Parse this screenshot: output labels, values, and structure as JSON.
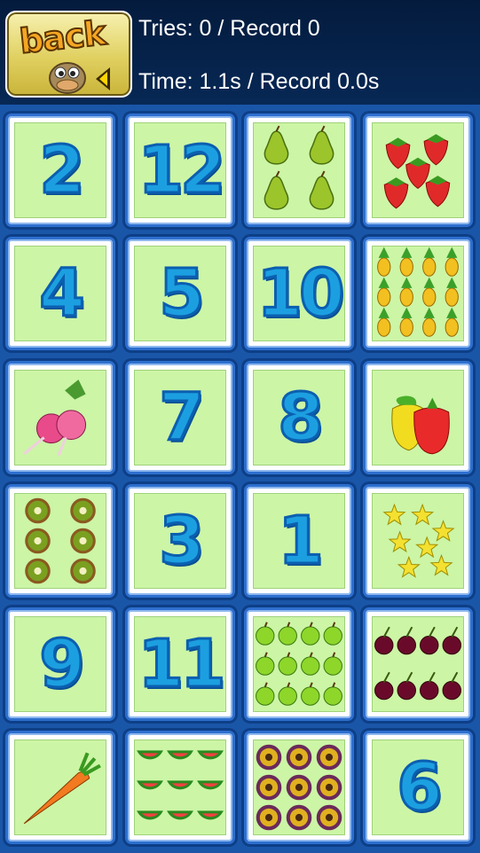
{
  "header": {
    "back_label": "back",
    "tries": "Tries: 0 / Record 0",
    "time": "Time: 1.1s / Record 0.0s"
  },
  "board": {
    "rows": [
      [
        {
          "kind": "number",
          "value": "2"
        },
        {
          "kind": "number",
          "value": "12"
        },
        {
          "kind": "picture",
          "name": "pears"
        },
        {
          "kind": "picture",
          "name": "strawberries"
        }
      ],
      [
        {
          "kind": "number",
          "value": "4"
        },
        {
          "kind": "number",
          "value": "5"
        },
        {
          "kind": "number",
          "value": "10"
        },
        {
          "kind": "picture",
          "name": "pineapples"
        }
      ],
      [
        {
          "kind": "picture",
          "name": "radishes"
        },
        {
          "kind": "number",
          "value": "7"
        },
        {
          "kind": "number",
          "value": "8"
        },
        {
          "kind": "picture",
          "name": "peppers"
        }
      ],
      [
        {
          "kind": "picture",
          "name": "kiwis"
        },
        {
          "kind": "number",
          "value": "3"
        },
        {
          "kind": "number",
          "value": "1"
        },
        {
          "kind": "picture",
          "name": "starfruits"
        }
      ],
      [
        {
          "kind": "number",
          "value": "9"
        },
        {
          "kind": "number",
          "value": "11"
        },
        {
          "kind": "picture",
          "name": "green-apples"
        },
        {
          "kind": "picture",
          "name": "cherries"
        }
      ],
      [
        {
          "kind": "picture",
          "name": "carrot"
        },
        {
          "kind": "picture",
          "name": "watermelon-slices"
        },
        {
          "kind": "picture",
          "name": "passion-fruits"
        },
        {
          "kind": "number",
          "value": "6"
        }
      ]
    ]
  },
  "colors": {
    "header_bg": "#041b3d",
    "board_bg": "#1a56a8",
    "card_face": "#ccf5a6",
    "number_fill": "#1c9fe0"
  }
}
